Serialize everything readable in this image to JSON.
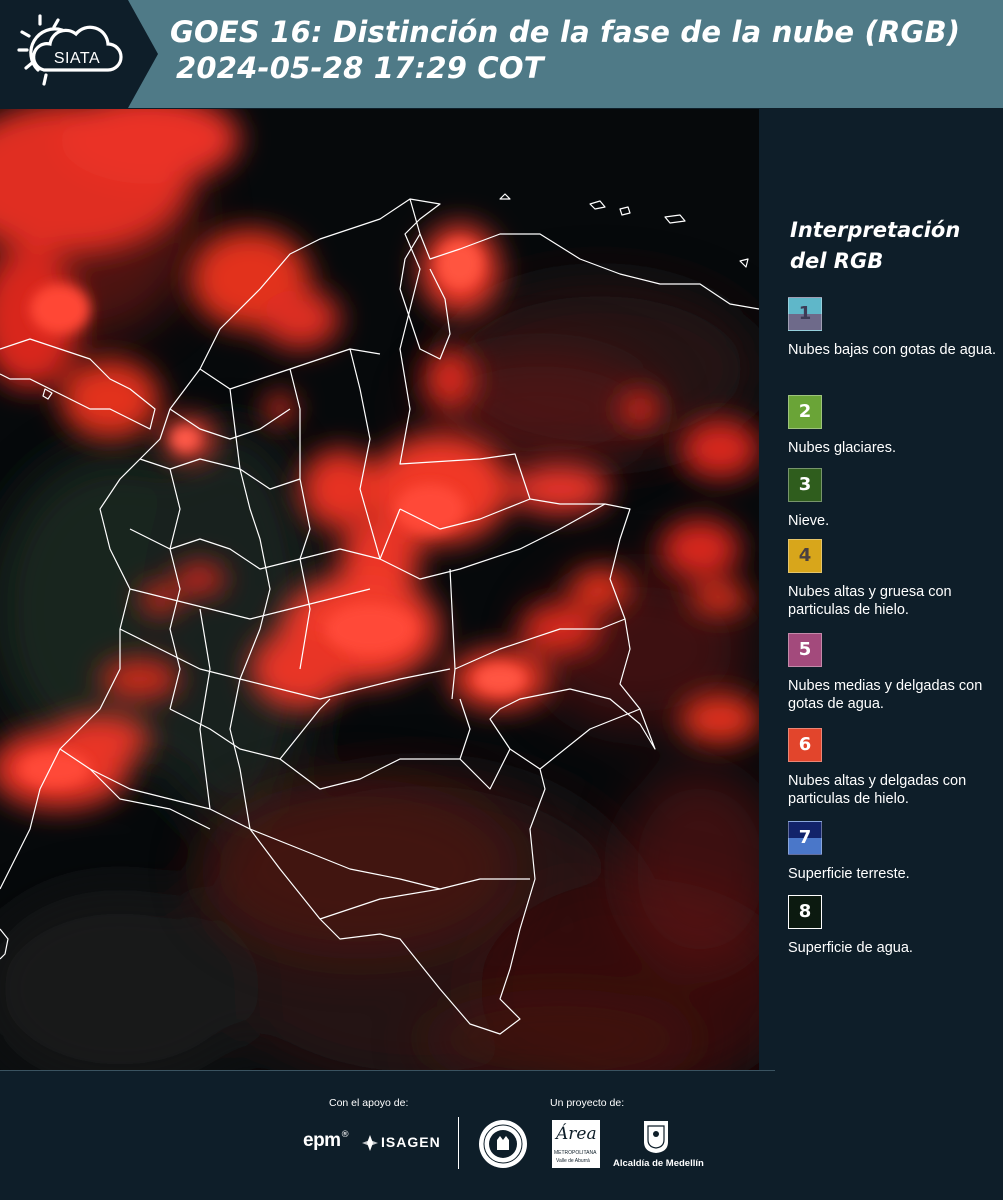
{
  "header": {
    "logo_text": "SIATA",
    "title_line1": "GOES 16: Distinción de la fase de la nube (RGB)",
    "title_line2": "2024-05-28 17:29 COT"
  },
  "legend": {
    "title": "Interpretación del RGB",
    "items": [
      {
        "num": "1",
        "desc": "Nubes bajas con gotas de agua.",
        "color_top": "#5fb7c9",
        "color_bottom": "#6e6a8a"
      },
      {
        "num": "2",
        "desc": "Nubes glaciares.",
        "color": "#6aa437"
      },
      {
        "num": "3",
        "desc": "Nieve.",
        "color": "#2f5d1d"
      },
      {
        "num": "4",
        "desc": "Nubes altas y gruesa con particulas de hielo.",
        "color": "#d8a61b"
      },
      {
        "num": "5",
        "desc": "Nubes medias y delgadas con gotas de agua.",
        "color": "#a34a7c"
      },
      {
        "num": "6",
        "desc": "Nubes altas y delgadas con particulas de hielo.",
        "color": "#e2452c"
      },
      {
        "num": "7",
        "desc": "Superficie terreste.",
        "color_top": "#12236a",
        "color_bottom": "#4a77c9"
      },
      {
        "num": "8",
        "desc": "Superficie de agua.",
        "color": "#0c1a10"
      }
    ]
  },
  "footer": {
    "support_label": "Con el apoyo de:",
    "project_label": "Un proyecto de:",
    "epm": "epm",
    "isagen": "ISAGEN",
    "area_text": "Área",
    "area_sub1": "METROPOLITANA",
    "area_sub2": "Valle de Aburrá",
    "alcaldia": "Alcaldía de Medellín"
  }
}
